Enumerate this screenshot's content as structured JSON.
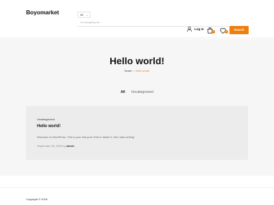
{
  "header": {
    "logo": "Boyomarket",
    "category_select": "All",
    "search_placeholder": "I'm shopping for...",
    "search_button": "Search",
    "login_label": "Log In",
    "cart_count": "0",
    "wishlist_count": "0"
  },
  "hero": {
    "title": "Hello world!",
    "breadcrumb": {
      "home": "Home",
      "separator": "/",
      "current": "Hello world!"
    }
  },
  "filters": [
    {
      "label": "All",
      "active": true
    },
    {
      "label": "Uncategorized",
      "active": false
    }
  ],
  "post": {
    "category": "Uncategorized",
    "title": "Hello world!",
    "excerpt": "Welcome to WordPress. This is your first post. Edit or delete it, then start writing!",
    "date": "September 30, 2018",
    "by": "by",
    "author": "admin"
  },
  "footer": {
    "copyright": "Copyright © 2018"
  },
  "colors": {
    "accent": "#f07e0c",
    "hero_bg": "#f6f6f6",
    "card_bg": "#ececec"
  },
  "icons": [
    "user-icon",
    "cart-icon",
    "heart-icon",
    "chevron-down-icon"
  ]
}
